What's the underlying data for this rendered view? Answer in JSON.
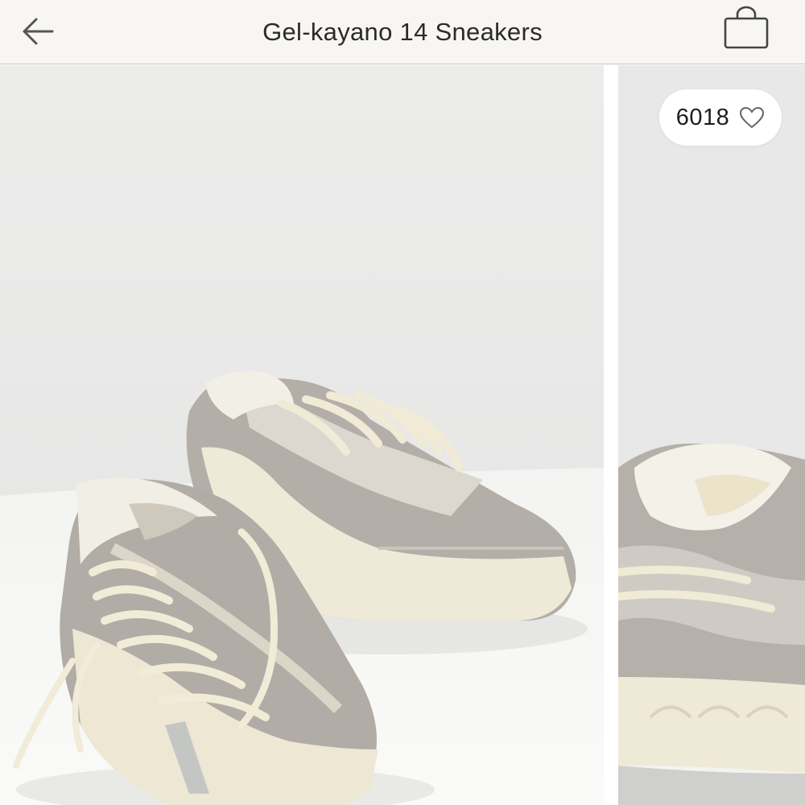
{
  "header": {
    "title": "Gel-kayano 14 Sneakers",
    "back_icon": "arrow-left-icon",
    "bag_icon": "shopping-bag-icon"
  },
  "gallery": {
    "favorites_count": "6018",
    "favorite_icon": "heart-outline-icon",
    "slides": [
      {
        "image": "Two grey and cream sneakers on a white surface"
      },
      {
        "image": "Close-up of a sneaker heel"
      }
    ]
  },
  "colors": {
    "header_bg": "#f8f6f3",
    "wall": "#e8e9e8",
    "floor": "#f6f6f4",
    "suede_grey": "#b1aca6",
    "cream": "#efe9d8"
  }
}
